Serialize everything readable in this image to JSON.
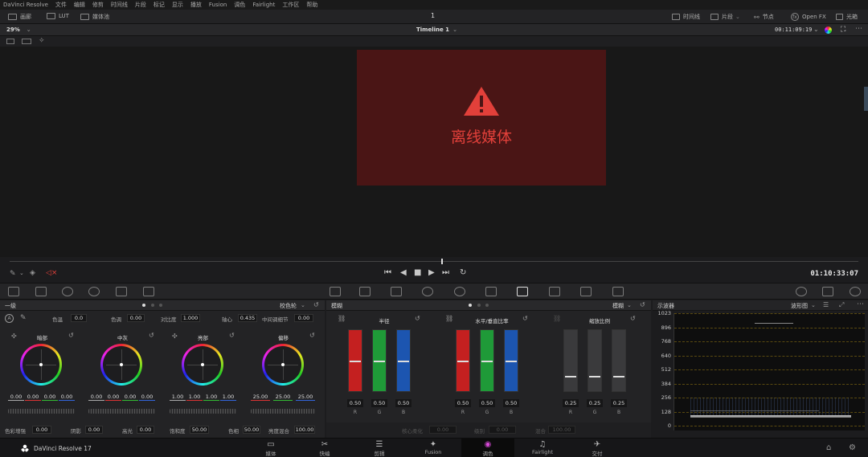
{
  "menubar": {
    "items": [
      "DaVinci Resolve",
      "文件",
      "编辑",
      "修剪",
      "时间线",
      "片段",
      "标记",
      "显示",
      "播放",
      "Fusion",
      "调色",
      "Fairlight",
      "工作区",
      "帮助"
    ]
  },
  "toolbar": {
    "gallery": "画廊",
    "lut": "LUT",
    "media_pool": "媒体池",
    "center_label": "1",
    "timeline": "时间线",
    "clips": "片段",
    "nodes": "节点",
    "openfx": "Open FX",
    "lightbox": "光箱"
  },
  "subbar": {
    "zoom": "29%",
    "timeline_name": "Timeline 1",
    "timecode": "00:11:09:19"
  },
  "viewer": {
    "offline_text": "离线媒体"
  },
  "transport": {
    "timecode": "01:10:33:07"
  },
  "primaries": {
    "title": "一级",
    "mode": "校色轮",
    "params_top": [
      {
        "label": "色温",
        "value": "0.0"
      },
      {
        "label": "色调",
        "value": "0.00"
      },
      {
        "label": "对比度",
        "value": "1.000"
      },
      {
        "label": "轴心",
        "value": "0.435"
      },
      {
        "label": "中间调细节",
        "value": "0.00"
      }
    ],
    "wheels": [
      {
        "name": "暗部",
        "values": [
          "0.00",
          "0.00",
          "0.00",
          "0.00"
        ]
      },
      {
        "name": "中灰",
        "values": [
          "0.00",
          "0.00",
          "0.00",
          "0.00"
        ]
      },
      {
        "name": "亮部",
        "values": [
          "1.00",
          "1.00",
          "1.00",
          "1.00"
        ]
      },
      {
        "name": "偏移",
        "values": [
          "25.00",
          "25.00",
          "25.00"
        ]
      }
    ],
    "params_bottom": [
      {
        "label": "色彩增强",
        "value": "0.00"
      },
      {
        "label": "阴影",
        "value": "0.00"
      },
      {
        "label": "高光",
        "value": "0.00"
      },
      {
        "label": "饱和度",
        "value": "50.00"
      },
      {
        "label": "色相",
        "value": "50.00"
      },
      {
        "label": "亮度混合",
        "value": "100.00"
      }
    ]
  },
  "blur": {
    "title": "模糊",
    "mode": "模糊",
    "groups": [
      {
        "name": "半径",
        "values": [
          "0.50",
          "0.50",
          "0.50"
        ],
        "fill": [
          0.5,
          0.5,
          0.5
        ],
        "colored": true
      },
      {
        "name": "水平/垂直比率",
        "values": [
          "0.50",
          "0.50",
          "0.50"
        ],
        "fill": [
          0.5,
          0.5,
          0.5
        ],
        "colored": true
      },
      {
        "name": "缩放比例",
        "values": [
          "0.25",
          "0.25",
          "0.25"
        ],
        "fill": [
          0.25,
          0.25,
          0.25
        ],
        "colored": false
      }
    ],
    "channels": [
      "R",
      "G",
      "B"
    ],
    "bottom": [
      {
        "label": "核心柔化",
        "value": "0.00"
      },
      {
        "label": "级别",
        "value": "0.00"
      },
      {
        "label": "混合",
        "value": "100.00"
      }
    ]
  },
  "scope": {
    "title": "示波器",
    "mode": "波形图",
    "labels": [
      "1023",
      "896",
      "768",
      "640",
      "512",
      "384",
      "256",
      "128",
      "0"
    ]
  },
  "bottom": {
    "app_name": "DaVinci Resolve 17",
    "pages": [
      {
        "label": "媒体",
        "icon": "media-icon"
      },
      {
        "label": "快编",
        "icon": "cut-icon"
      },
      {
        "label": "剪辑",
        "icon": "edit-icon"
      },
      {
        "label": "Fusion",
        "icon": "fusion-icon"
      },
      {
        "label": "调色",
        "icon": "color-icon"
      },
      {
        "label": "Fairlight",
        "icon": "fairlight-icon"
      },
      {
        "label": "交付",
        "icon": "deliver-icon"
      }
    ],
    "active_page": "调色"
  },
  "colors": {
    "offline_bg": "#4a1515",
    "offline_text": "#e2403a",
    "red_bar": "#c42020",
    "green_bar": "#1f9a38",
    "blue_bar": "#1c55b0"
  }
}
